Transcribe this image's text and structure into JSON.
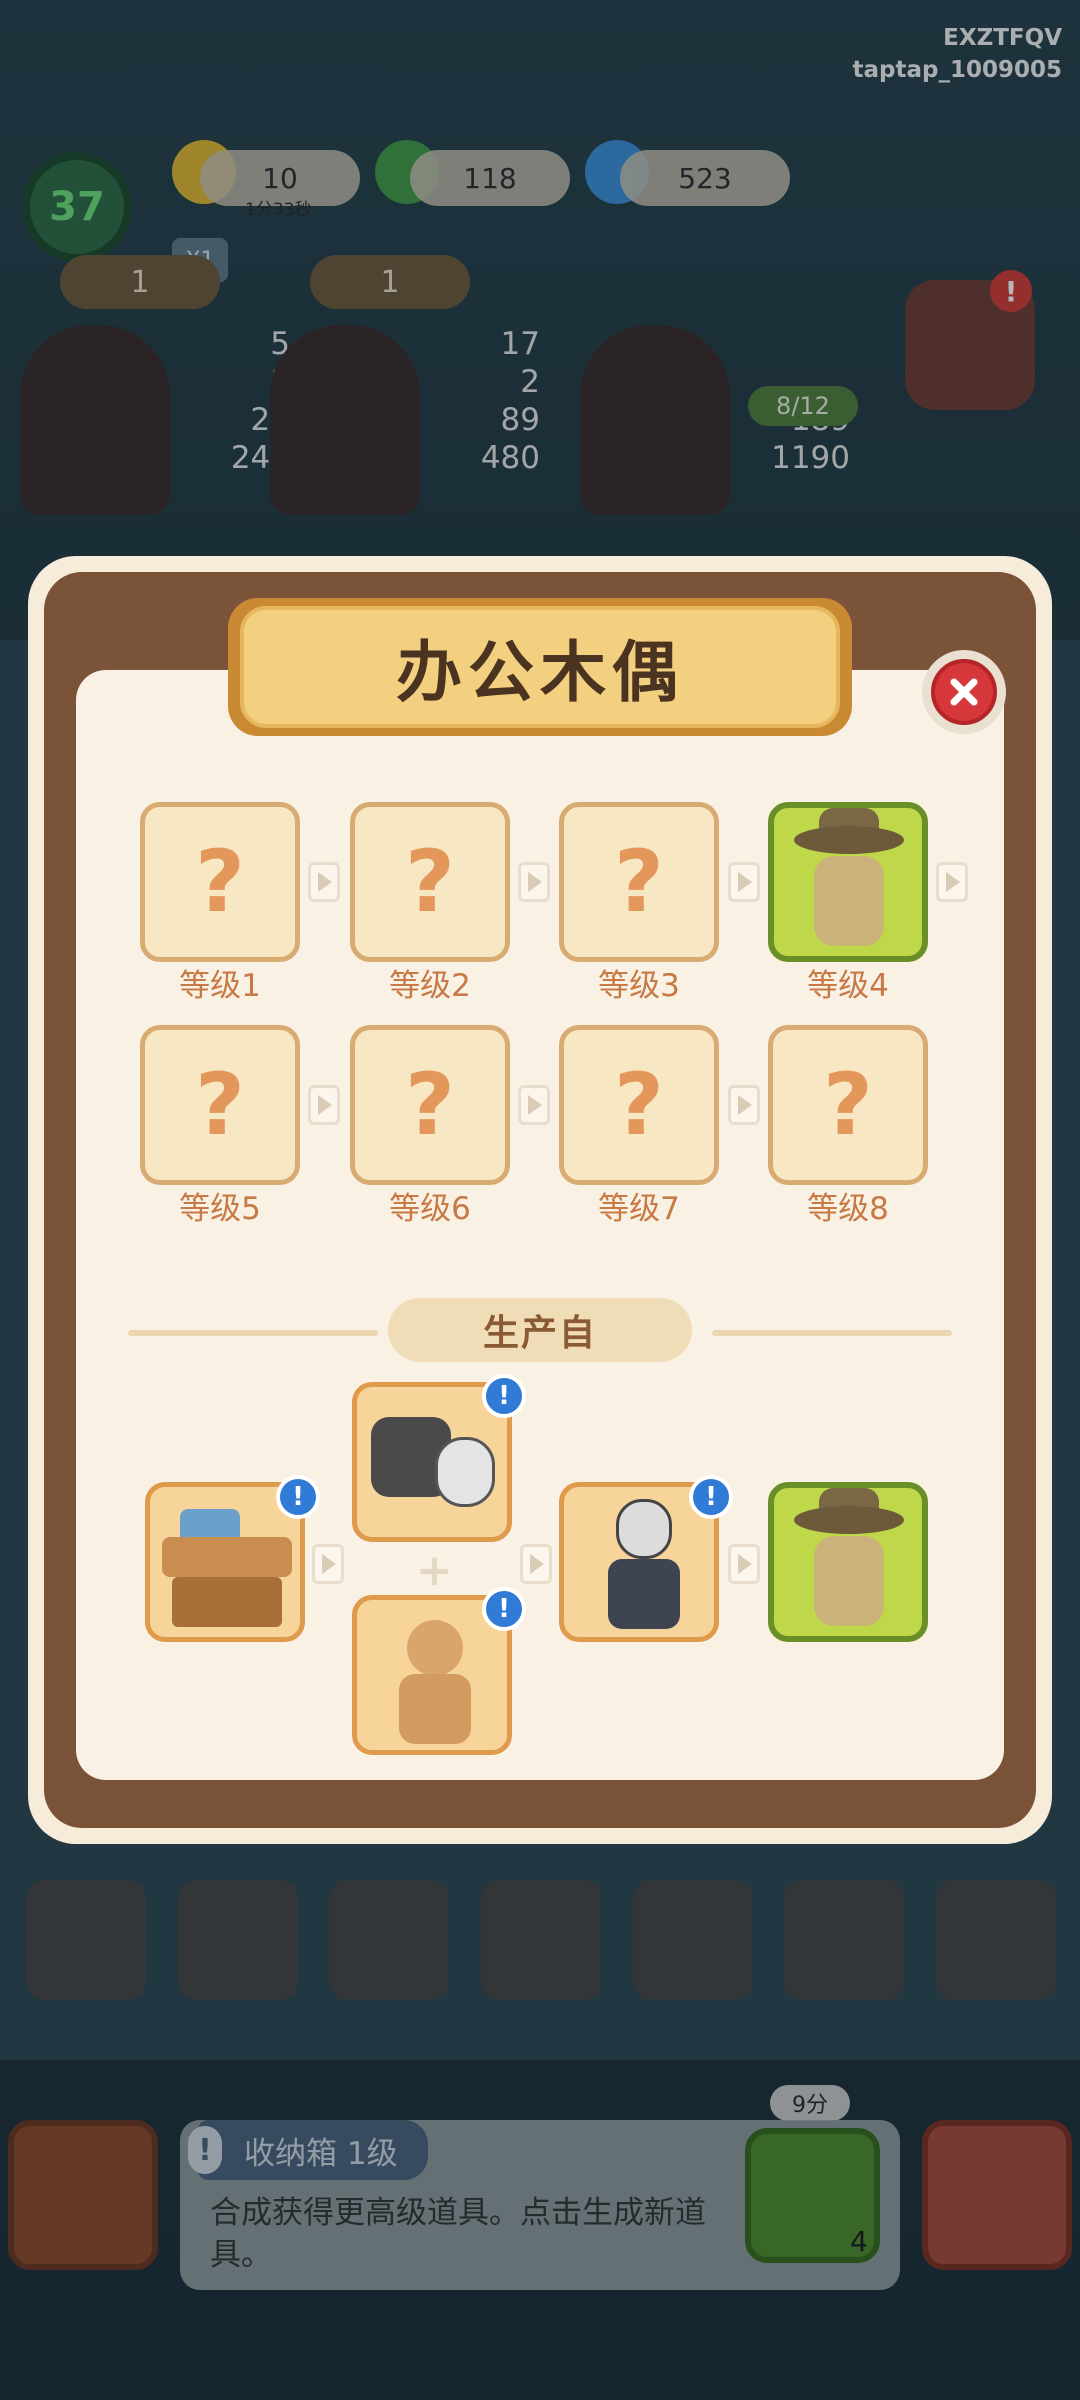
{
  "header": {
    "account_code": "EXZTFQV",
    "account_user": "taptap_1009005",
    "player_level": "37",
    "resources": [
      {
        "name": "energy",
        "icon": "lightning-icon",
        "value": "10",
        "sub": "1分33秒"
      },
      {
        "name": "coins",
        "icon": "jade-coin-icon",
        "value": "118"
      },
      {
        "name": "gems",
        "icon": "blue-flame-icon",
        "value": "523"
      }
    ],
    "multiplier": "X1"
  },
  "characters": [
    {
      "level": "1",
      "stats": [
        "5",
        "1",
        "23",
        "240"
      ]
    },
    {
      "level": "1",
      "stats": [
        "17",
        "2",
        "89",
        "480"
      ]
    },
    {
      "level": "",
      "progress": "8/12",
      "stats": [
        "189",
        "1190"
      ]
    }
  ],
  "modal": {
    "title": "办公木偶",
    "close_icon": "close-icon",
    "tiers": [
      {
        "label": "等级1",
        "unlocked": false
      },
      {
        "label": "等级2",
        "unlocked": false
      },
      {
        "label": "等级3",
        "unlocked": false
      },
      {
        "label": "等级4",
        "unlocked": true,
        "icon": "hat-puppet-icon"
      },
      {
        "label": "等级5",
        "unlocked": false
      },
      {
        "label": "等级6",
        "unlocked": false
      },
      {
        "label": "等级7",
        "unlocked": false
      },
      {
        "label": "等级8",
        "unlocked": false
      }
    ],
    "locked_glyph": "?",
    "section_label": "生产自",
    "production_chain": [
      {
        "icon": "workbench-icon",
        "badge": "!"
      },
      {
        "icon": "cloth-and-mask-icon",
        "badge": "!"
      },
      {
        "icon": "wooden-dummy-icon",
        "badge": "!"
      },
      {
        "icon": "masked-puppet-icon",
        "badge": "!"
      },
      {
        "icon": "hat-puppet-icon"
      }
    ],
    "plus_glyph": "+"
  },
  "bottom_bar": {
    "item_title": "收纳箱 1级",
    "item_desc": "合成获得更高级道具。点击生成新道具。",
    "timer": "9分",
    "generator_count": "4"
  },
  "colors": {
    "modal_brown": "#7b5338",
    "title_gold": "#f3cf80",
    "locked_tile": "#f8e7c3",
    "active_tile": "#bfd84a",
    "label_orange": "#c77a46",
    "close_red": "#d6373a",
    "info_blue": "#2f7bd6"
  }
}
